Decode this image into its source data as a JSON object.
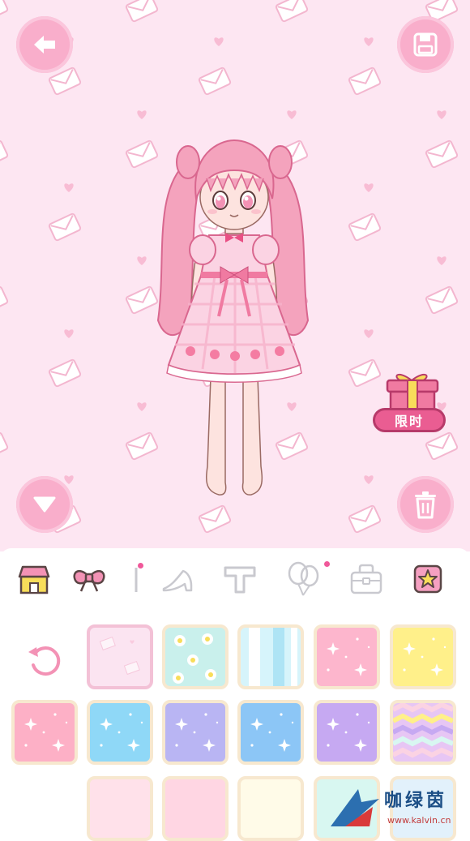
{
  "toolbar": {
    "back_icon": "back-arrow-icon",
    "save_icon": "save-disk-icon",
    "collapse_icon": "triangle-down-icon",
    "delete_icon": "trash-icon"
  },
  "gift": {
    "label": "限时",
    "icon": "gift-box-icon"
  },
  "tabs": [
    {
      "name": "tab-background",
      "icon": "house-icon",
      "active": true
    },
    {
      "name": "tab-bow",
      "icon": "bow-icon",
      "active": false
    },
    {
      "name": "tab-accessory",
      "icon": "stick-icon",
      "badge": true
    },
    {
      "name": "tab-shoes",
      "icon": "high-heel-icon"
    },
    {
      "name": "tab-text",
      "icon": "letter-t-icon"
    },
    {
      "name": "tab-balloons",
      "icon": "balloons-icon",
      "badge": true
    },
    {
      "name": "tab-bag",
      "icon": "handbag-icon"
    },
    {
      "name": "tab-favorites",
      "icon": "star-icon"
    }
  ],
  "palette": {
    "reset_icon": "reset-rotate-icon",
    "swatches": [
      {
        "id": "envelope-pink",
        "base": "#fbe4f1",
        "pattern": "envelope",
        "selected": true
      },
      {
        "id": "daisy-mint",
        "base": "#c9f0ec",
        "pattern": "daisy"
      },
      {
        "id": "stripe-blue",
        "base": "#d6f4fb",
        "pattern": "stripes"
      },
      {
        "id": "sparkle-pink",
        "base": "#fdb6cd",
        "pattern": "sparkle"
      },
      {
        "id": "sparkle-yellow",
        "base": "#fff08a",
        "pattern": "sparkle"
      },
      {
        "id": "sparkle-rose",
        "base": "#fdb0c6",
        "pattern": "sparkle"
      },
      {
        "id": "sparkle-sky",
        "base": "#8fd8f7",
        "pattern": "sparkle"
      },
      {
        "id": "sparkle-lilac",
        "base": "#b9b5f3",
        "pattern": "sparkle"
      },
      {
        "id": "sparkle-blue",
        "base": "#8cc6f6",
        "pattern": "star"
      },
      {
        "id": "sparkle-purple",
        "base": "#c6a9f2",
        "pattern": "sparkle"
      },
      {
        "id": "chevron-pastel",
        "base": "#e7c6f4",
        "pattern": "chevron"
      },
      {
        "id": "plain-blush",
        "base": "#ffe1ea",
        "pattern": "none"
      },
      {
        "id": "plain-pink",
        "base": "#ffd6e3",
        "pattern": "none"
      },
      {
        "id": "plain-cream",
        "base": "#fffbe8",
        "pattern": "none"
      },
      {
        "id": "plain-mint",
        "base": "#d8f7f1",
        "pattern": "none"
      },
      {
        "id": "plain-ice",
        "base": "#e2f1fb",
        "pattern": "none"
      }
    ]
  },
  "watermark": {
    "title": "咖绿茵",
    "url": "www.kalvin.cn"
  }
}
